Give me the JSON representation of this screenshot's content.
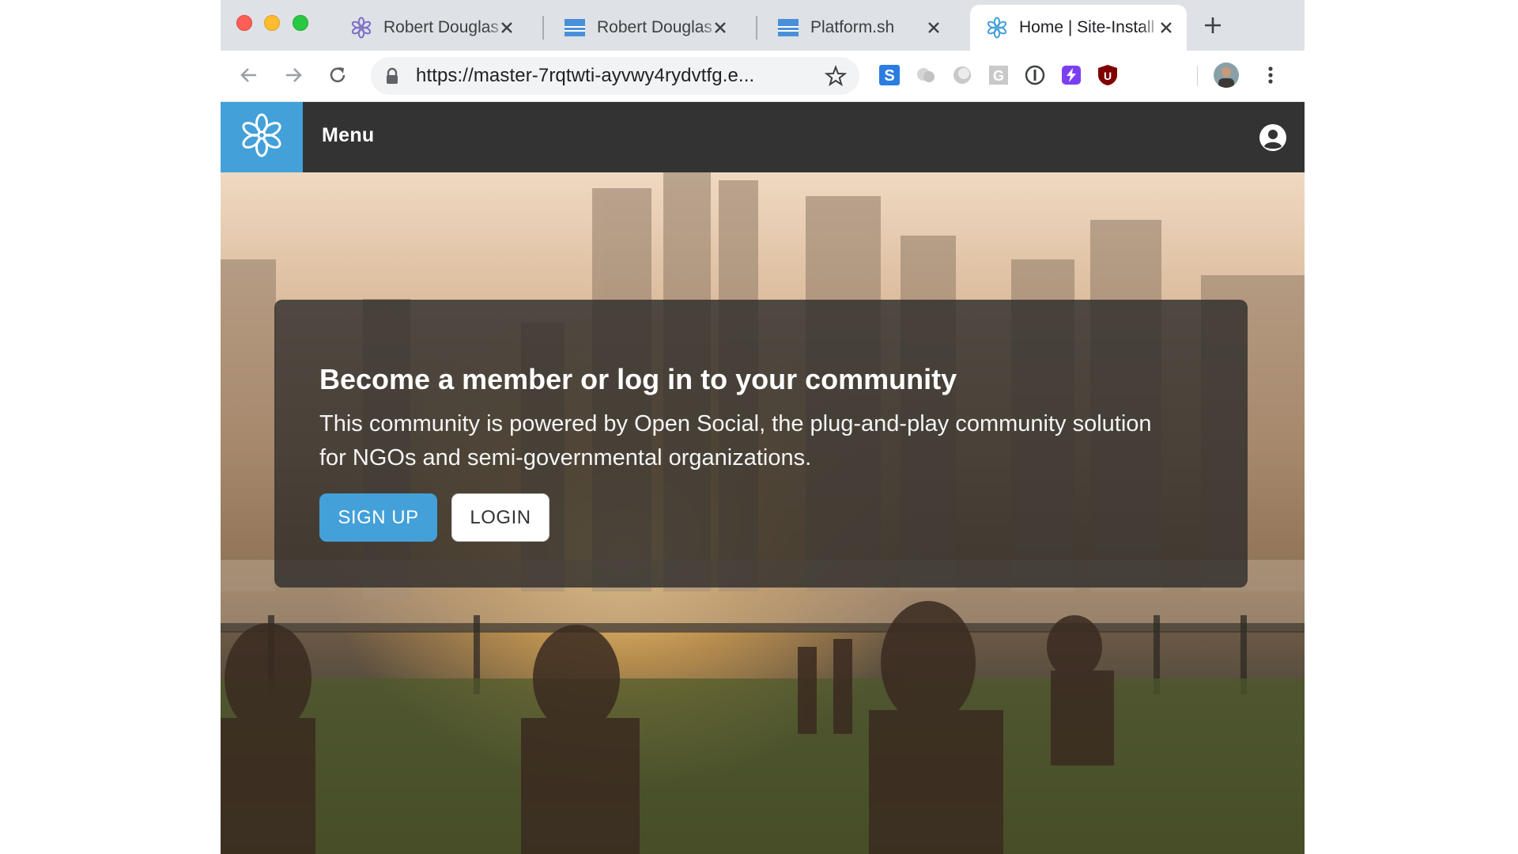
{
  "browser": {
    "tabs": [
      {
        "title": "Robert Douglas",
        "favicon": "flower-icon",
        "active": false
      },
      {
        "title": "Robert Douglas",
        "favicon": "doc-lines-icon",
        "active": false
      },
      {
        "title": "Platform.sh",
        "favicon": "doc-lines-icon",
        "active": false
      },
      {
        "title": "Home | Site-Install",
        "favicon": "flower-icon",
        "active": true
      }
    ],
    "url": "https://master-7rqtwti-ayvwy4rydvtfg.e...",
    "extensions": [
      "skype-s-icon",
      "cloud-icon",
      "circle-icon",
      "grammarly-g-icon",
      "onepassword-icon",
      "purple-bolt-icon",
      "ublock-u-icon"
    ]
  },
  "site": {
    "menu_label": "Menu",
    "brand_color": "#43a0d9",
    "navbar_color": "#333333"
  },
  "hero": {
    "title": "Become a member or log in to your community",
    "description": "This community is powered by Open Social, the plug-and-play community solution for NGOs and semi-governmental organizations.",
    "signup_label": "SIGN UP",
    "login_label": "LOGIN"
  }
}
